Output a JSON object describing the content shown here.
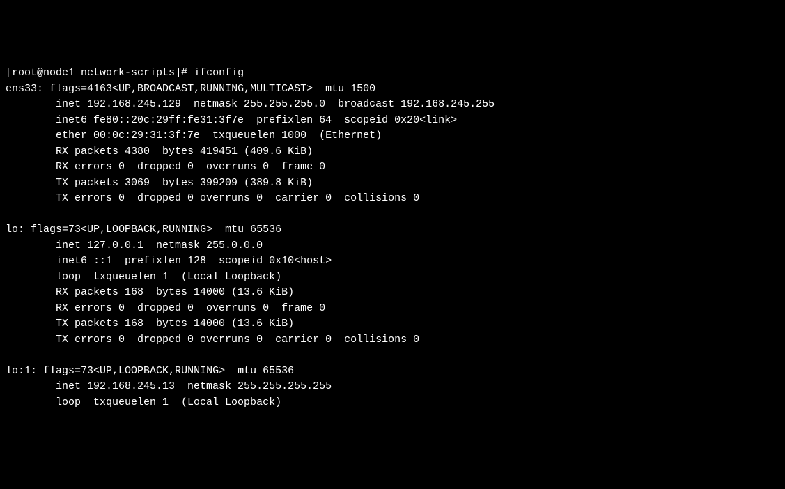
{
  "prompt": {
    "user_host": "[root@node1 network-scripts]#",
    "command": "ifconfig"
  },
  "interfaces": {
    "ens33": {
      "name": "ens33:",
      "flags": "flags=4163<UP,BROADCAST,RUNNING,MULTICAST>  mtu 1500",
      "inet": "inet 192.168.245.129  netmask 255.255.255.0  broadcast 192.168.245.255",
      "inet6": "inet6 fe80::20c:29ff:fe31:3f7e  prefixlen 64  scopeid 0x20<link>",
      "ether": "ether 00:0c:29:31:3f:7e  txqueuelen 1000  (Ethernet)",
      "rx_packets": "RX packets 4380  bytes 419451 (409.6 KiB)",
      "rx_errors": "RX errors 0  dropped 0  overruns 0  frame 0",
      "tx_packets": "TX packets 3069  bytes 399209 (389.8 KiB)",
      "tx_errors": "TX errors 0  dropped 0 overruns 0  carrier 0  collisions 0"
    },
    "lo": {
      "name": "lo:",
      "flags": "flags=73<UP,LOOPBACK,RUNNING>  mtu 65536",
      "inet": "inet 127.0.0.1  netmask 255.0.0.0",
      "inet6": "inet6 ::1  prefixlen 128  scopeid 0x10<host>",
      "loop": "loop  txqueuelen 1  (Local Loopback)",
      "rx_packets": "RX packets 168  bytes 14000 (13.6 KiB)",
      "rx_errors": "RX errors 0  dropped 0  overruns 0  frame 0",
      "tx_packets": "TX packets 168  bytes 14000 (13.6 KiB)",
      "tx_errors": "TX errors 0  dropped 0 overruns 0  carrier 0  collisions 0"
    },
    "lo1": {
      "name": "lo:1:",
      "flags": "flags=73<UP,LOOPBACK,RUNNING>  mtu 65536",
      "inet": "inet 192.168.245.13  netmask 255.255.255.255",
      "loop": "loop  txqueuelen 1  (Local Loopback)"
    }
  }
}
